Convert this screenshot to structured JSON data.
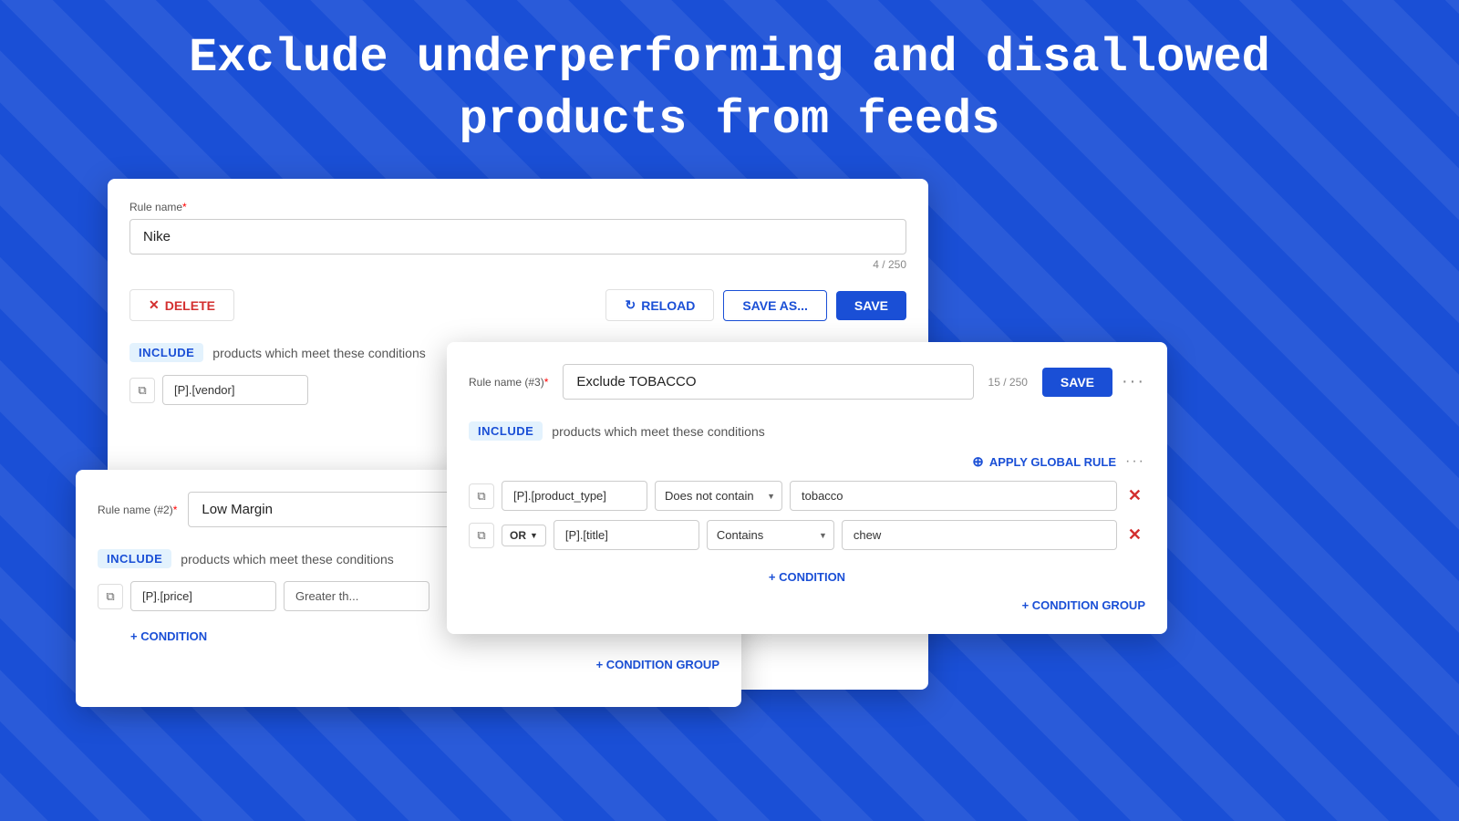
{
  "headline": {
    "line1": "Exclude underperforming and disallowed",
    "line2": "products from feeds"
  },
  "card1": {
    "rule_label": "Rule name",
    "required_mark": "*",
    "rule_value": "Nike",
    "char_count": "4 / 250",
    "delete_btn": "DELETE",
    "reload_btn": "RELOAD",
    "save_as_btn": "SAVE AS...",
    "save_btn": "SAVE",
    "include_badge": "INCLUDE",
    "include_text": "products which meet these conditions",
    "condition_field": "[P].[vendor]"
  },
  "card2": {
    "rule_label": "Rule name (#2)",
    "required_mark": "*",
    "rule_value": "Low Margin",
    "include_badge": "INCLUDE",
    "include_text": "products which meet these conditions",
    "condition_field": "[P].[price]",
    "condition_op": "Greater th...",
    "add_condition": "+ CONDITION",
    "add_condition_group": "+ CONDITION GROUP"
  },
  "card3": {
    "rule_label": "Rule name (#3)",
    "required_mark": "*",
    "char_count": "15 / 250",
    "rule_value": "Exclude TOBACCO",
    "save_btn": "SAVE",
    "include_badge": "INCLUDE",
    "include_text": "products which meet these conditions",
    "apply_global": "APPLY GLOBAL RULE",
    "condition1_field": "[P].[product_type]",
    "condition1_op": "Does not contain",
    "condition1_value": "tobacco",
    "condition2_or": "OR",
    "condition2_field": "[P].[title]",
    "condition2_op": "Contains",
    "condition2_value": "chew",
    "add_condition": "+ CONDITION",
    "add_condition_group": "+ CONDITION GROUP"
  }
}
